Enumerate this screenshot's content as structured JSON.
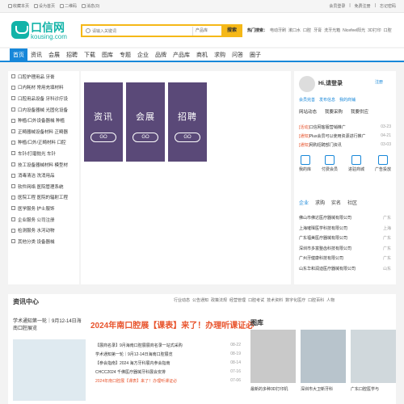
{
  "topbar": {
    "left": [
      "收藏本页",
      "设为首页",
      "二维码",
      "消息(0)"
    ],
    "right": [
      "会员登录",
      "免费注册",
      "忘记密码"
    ]
  },
  "logo": {
    "cn": "口信网",
    "en": "kousing.com"
  },
  "search": {
    "placeholder": "请输入关键词",
    "scope": "产品库",
    "button": "搜索"
  },
  "hot": {
    "label": "热门搜索：",
    "items": [
      "电动牙刷",
      "漱口水",
      "口腔",
      "牙膏",
      "洗牙光箱",
      "Nicefeel阳光",
      "3D打印",
      "口腔"
    ]
  },
  "nav": [
    "首页",
    "资讯",
    "会展",
    "招聘",
    "下载",
    "图库",
    "专题",
    "企业",
    "品牌",
    "产品库",
    "商机",
    "求购",
    "问答",
    "圈子"
  ],
  "sidebar": [
    "口腔护理用品 牙膏",
    "口内耗材 常用充填材料",
    "口腔用品设备 牙科诊疗设",
    "口内设备器械 光固化设备",
    "种植/口外设备器械 种植",
    "正畸器械设备材料 正畸器",
    "种植/口外/正畸材料 口腔",
    "车针/打磨抛光 车针",
    "技工设备器械材料 模型材",
    "消毒清洁 洗消用品",
    "软件网络 医院管理系统",
    "医院工程 医院的辐射工程",
    "医学服务 护士服饰",
    "企业服务 公司注册",
    "检测服务 水河动物",
    "其他分类 设备器械"
  ],
  "promos": [
    {
      "title": "资讯",
      "go": "GO"
    },
    {
      "title": "会展",
      "go": "GO"
    },
    {
      "title": "招聘",
      "go": "GO"
    }
  ],
  "user": {
    "greeting": "Hi,请登录",
    "register": "注册",
    "links": [
      "会员完善",
      "发布信息",
      "我的商铺"
    ],
    "tabs": [
      "网站动态",
      "我要采购",
      "我要供应"
    ]
  },
  "notices": [
    {
      "tag": "[活动]",
      "text": "口信网客服营销推广",
      "date": "03-23"
    },
    {
      "tag": "[通知]",
      "text": "Plus会员可以使用资源进行推广",
      "date": "04-21"
    },
    {
      "tag": "[通知]",
      "text": "网购招聘部门资讯",
      "date": "03-03"
    }
  ],
  "quick": [
    "我的库",
    "付费会员",
    "进驻商城",
    "广告投放"
  ],
  "company_tabs": [
    "企业",
    "求购",
    "实名",
    "社区"
  ],
  "companies": [
    {
      "name": "佛山市佛达医疗器械有限公司",
      "region": "广东"
    },
    {
      "name": "上海璀璨医学科技有限公司",
      "region": "上海"
    },
    {
      "name": "广东福美医疗器械有限公司",
      "region": "广东"
    },
    {
      "name": "深圳市多富整齿科技有限公司",
      "region": "广东"
    },
    {
      "name": "广州牙健康科技有限公司",
      "region": "广东"
    },
    {
      "name": "山东华和润迪医疗器械有限公司",
      "region": "山东"
    }
  ],
  "news": {
    "title": "资讯中心",
    "tabs": [
      "行业动态",
      "公告通知",
      "政策法规",
      "经营管理",
      "口腔考试",
      "技术资料",
      "数字化医疗",
      "口腔百科",
      "人物"
    ],
    "side_title": "学术通知第一轮｜9月12-14日海南口腔展览",
    "headline": "2024年南口腔展【课表】来了！办理听课证必",
    "items": [
      {
        "text": "【展商名录】9月海南口腔展展商名录一站式采购",
        "date": "08-22"
      },
      {
        "text": "学术通知第一轮｜9月12-14日海南口腔展览",
        "date": "08-19"
      },
      {
        "text": "【参会指南】2024 海方牙科展内参会指南",
        "date": "08-14"
      },
      {
        "text": "CHCC2024 千佛医疗器械牙科展会安排",
        "date": "07-16"
      },
      {
        "text": "2024年南口腔展【课表】来了！办理听课证必",
        "date": "07-06"
      }
    ],
    "gallery_title": "图库",
    "gallery": [
      "最新的多种3D打印机",
      "深圳市大卫新牙科",
      "广东口腔医学与"
    ]
  },
  "colors": {
    "primary": "#1787d9",
    "accent": "#f5b818",
    "brand": "#12b3a8",
    "promo": "#5a4978",
    "headline": "#e8542d"
  },
  "icons": {
    "search": "search-icon"
  }
}
